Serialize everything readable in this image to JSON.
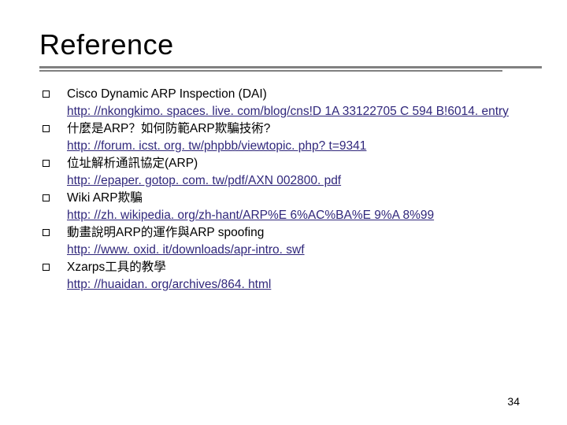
{
  "title": "Reference",
  "items": [
    {
      "title": "Cisco Dynamic ARP Inspection (DAI)",
      "link": "http: //nkongkimo. spaces. live. com/blog/cns!D 1A 33122705 C 594 B!6014. entry"
    },
    {
      "title": "什麼是ARP？如何防範ARP欺騙技術?",
      "link": "http: //forum. icst. org. tw/phpbb/viewtopic. php? t=9341"
    },
    {
      "title": "位址解析通訊協定(ARP)",
      "link": "http: //epaper. gotop. com. tw/pdf/AXN 002800. pdf"
    },
    {
      "title": "Wiki ARP欺騙",
      "link": "http: //zh. wikipedia. org/zh-hant/ARP%E 6%AC%BA%E 9%A 8%99"
    },
    {
      "title": "動畫說明ARP的運作與ARP spoofing",
      "link": "http: //www. oxid. it/downloads/apr-intro. swf"
    },
    {
      "title": "Xzarps工具的教學",
      "link": "http: //huaidan. org/archives/864. html"
    }
  ],
  "page_number": "34"
}
